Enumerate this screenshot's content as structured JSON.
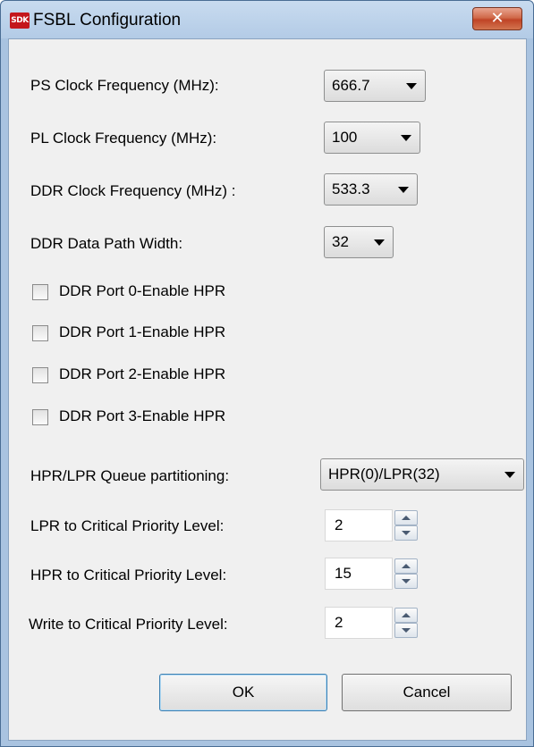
{
  "window": {
    "title": "FSBL Configuration",
    "app_icon_text": "SDK",
    "close_glyph": "✕"
  },
  "form": {
    "ps_clock": {
      "label": "PS Clock Frequency (MHz):",
      "value": "666.7"
    },
    "pl_clock": {
      "label": "PL Clock Frequency (MHz):",
      "value": "100"
    },
    "ddr_clock": {
      "label": "DDR Clock Frequency (MHz) :",
      "value": "533.3"
    },
    "ddr_width": {
      "label": "DDR Data Path Width:",
      "value": "32"
    },
    "ports": [
      {
        "label": "DDR Port 0-Enable HPR",
        "checked": false
      },
      {
        "label": "DDR Port 1-Enable HPR",
        "checked": false
      },
      {
        "label": "DDR Port 2-Enable HPR",
        "checked": false
      },
      {
        "label": "DDR Port 3-Enable HPR",
        "checked": false
      }
    ],
    "queue": {
      "label": "HPR/LPR Queue partitioning:",
      "value": "HPR(0)/LPR(32)"
    },
    "lpr": {
      "label": "LPR to Critical Priority Level:",
      "value": "2"
    },
    "hpr": {
      "label": "HPR to Critical Priority Level:",
      "value": "15"
    },
    "write": {
      "label": "Write to Critical Priority Level:",
      "value": "2"
    }
  },
  "buttons": {
    "ok": "OK",
    "cancel": "Cancel"
  }
}
